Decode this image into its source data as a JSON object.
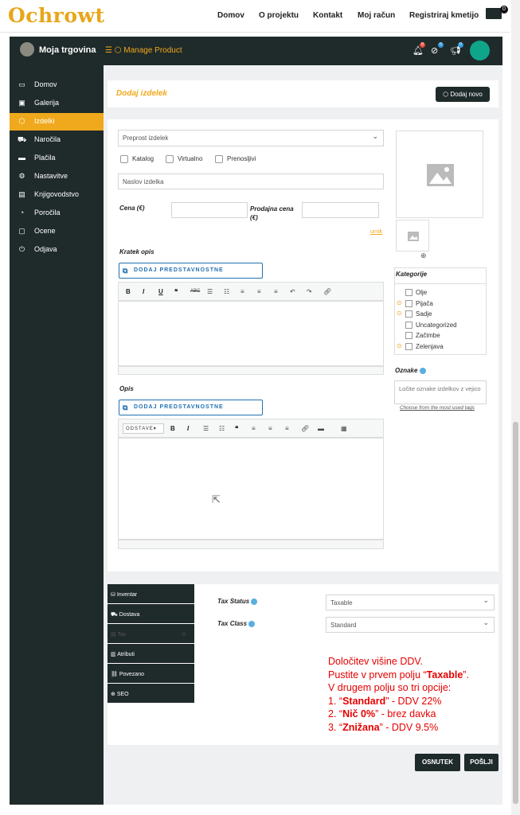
{
  "site": {
    "logo": "Ochrowt",
    "nav": [
      "Domov",
      "O projektu",
      "Kontakt",
      "Moj račun",
      "Registriraj kmetijo"
    ],
    "cart_count": "0"
  },
  "app": {
    "store_name": "Moja trgovina",
    "breadcrumb": "Manage Product",
    "notif_badges": [
      "8",
      "0",
      "0"
    ]
  },
  "sidebar": {
    "items": [
      "Domov",
      "Galerija",
      "Izdelki",
      "Naročila",
      "Plačila",
      "Nastavitve",
      "Knjigovodstvo",
      "Poročila",
      "Ocene",
      "Odjava"
    ],
    "active": "Izdelki"
  },
  "header": {
    "title": "Dodaj izdelek",
    "add_new": "Dodaj novo"
  },
  "form": {
    "product_type": "Preprost izdelek",
    "checkboxes": [
      "Katalog",
      "Virtualno",
      "Prenosljivi"
    ],
    "title_placeholder": "Naslov izdelka",
    "price_label": "Cena (€)",
    "sale_price_label": "Prodajna cena (€)",
    "schedule_link": "urnik",
    "short_desc_label": "Kratek opis",
    "desc_label": "Opis",
    "add_media": "DODAJ PREDSTAVNOSTNE DATOTEKE",
    "format_select": "ODSTAVE"
  },
  "categories": {
    "title": "Kategorije",
    "items": [
      "Olje",
      "Pijača",
      "Sadje",
      "Uncategorized",
      "Začimbe",
      "Zelenjava"
    ]
  },
  "tags": {
    "title": "Oznake",
    "placeholder": "Ločite oznake izdelkov z vejico",
    "link": "Choose from the most used tags"
  },
  "tabs": [
    "Inventar",
    "Dostava",
    "Tax",
    "Atributi",
    "Povezano",
    "SEO"
  ],
  "tax": {
    "status_label": "Tax Status",
    "status_value": "Taxable",
    "class_label": "Tax Class",
    "class_value": "Standard"
  },
  "note": {
    "line1": "Določitev višine DDV.",
    "line2_a": "Pustite v prvem polju “",
    "line2_b": "Taxable",
    "line2_c": "”.",
    "line3": "V drugem polju so tri opcije:",
    "opt1_a": "1. “",
    "opt1_b": "Standard",
    "opt1_c": "” - DDV 22%",
    "opt2_a": "2. “",
    "opt2_b": "Nič 0%",
    "opt2_c": "” - brez davka",
    "opt3_a": "3. “",
    "opt3_b": "Znižana",
    "opt3_c": "” - DDV 9.5%"
  },
  "buttons": {
    "draft": "OSNUTEK",
    "publish": "POŠLJI"
  },
  "colors": {
    "accent": "#f0a91c",
    "dark": "#1f2a2a",
    "note": "#e60000"
  }
}
